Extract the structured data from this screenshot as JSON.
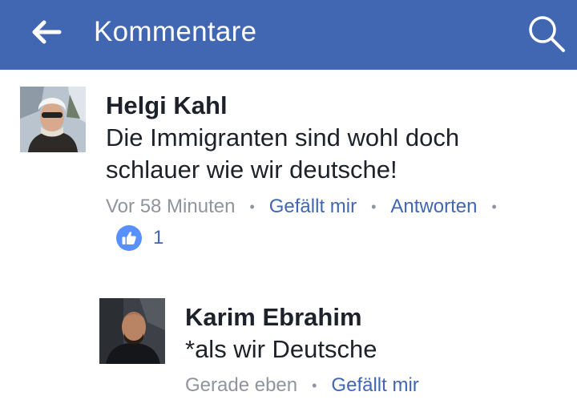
{
  "header": {
    "title": "Kommentare",
    "back_icon": "arrow-left-icon",
    "search_icon": "search-icon",
    "background": "#4267b2"
  },
  "comments": [
    {
      "author": "Helgi Kahl",
      "text": "Die Immigranten sind wohl doch schlauer wie wir deutsche!",
      "time": "Vor 58 Minuten",
      "like_label": "Gefällt mir",
      "reply_label": "Antworten",
      "reaction_count": "1",
      "reaction_icon": "thumbs-up-icon"
    },
    {
      "author": "Karim Ebrahim",
      "text": "*als wir Deutsche",
      "time": "Gerade eben",
      "like_label": "Gefällt mir"
    }
  ],
  "colors": {
    "accent": "#4267b2",
    "like_badge": "#5890ff",
    "meta_gray": "#90949c",
    "text": "#1d2129"
  }
}
